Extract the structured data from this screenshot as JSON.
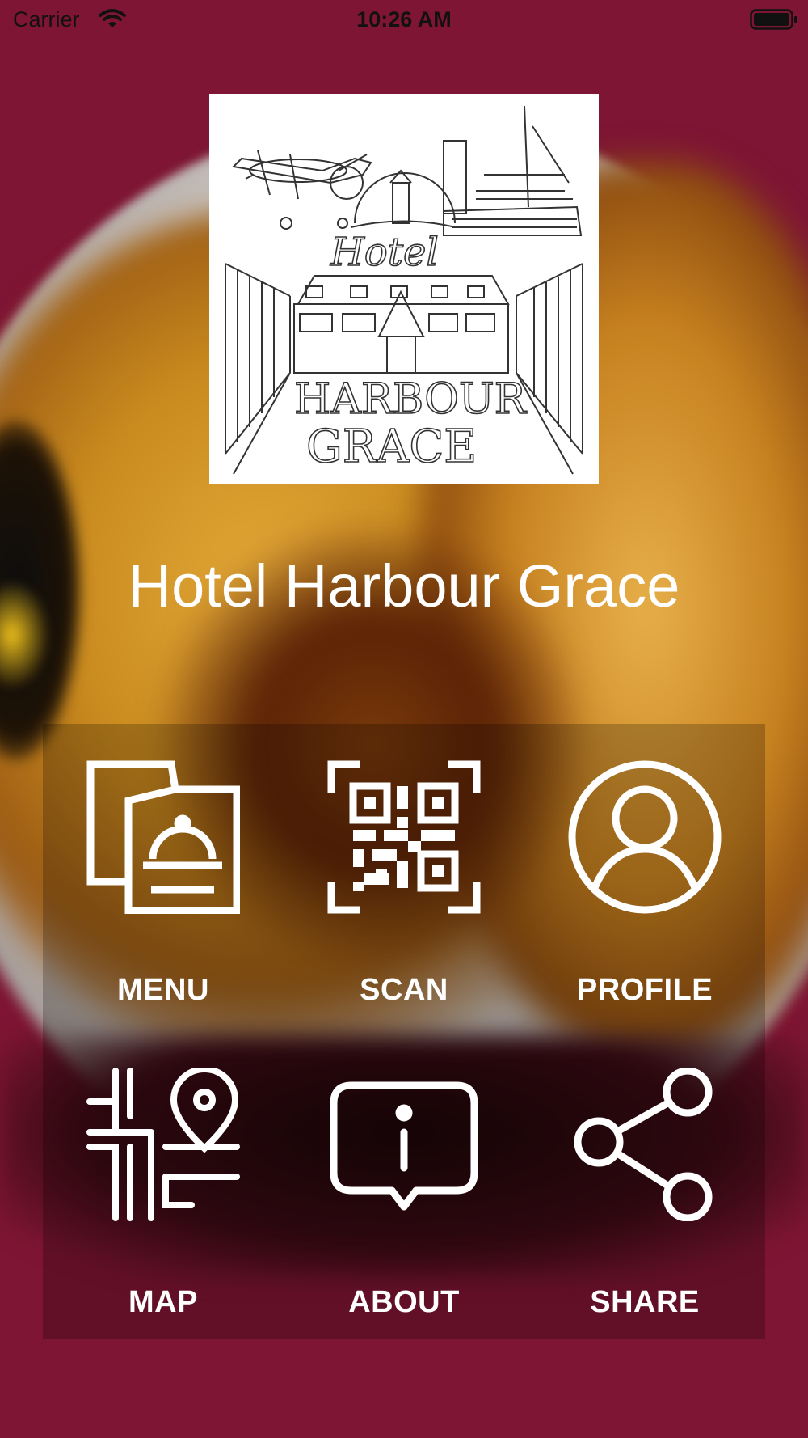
{
  "status_bar": {
    "carrier": "Carrier",
    "time": "10:26 AM"
  },
  "logo": {
    "icon": "hotel-harbour-grace-logo",
    "lines": [
      "Hotel",
      "HARBOUR",
      "GRACE"
    ]
  },
  "app_title": "Hotel Harbour Grace",
  "colors": {
    "background": "#7e1534",
    "text": "#ffffff"
  },
  "tiles": [
    {
      "label": "MENU",
      "icon": "menu-cloche-icon"
    },
    {
      "label": "SCAN",
      "icon": "qr-code-icon"
    },
    {
      "label": "PROFILE",
      "icon": "user-profile-icon"
    },
    {
      "label": "MAP",
      "icon": "map-pin-icon"
    },
    {
      "label": "ABOUT",
      "icon": "info-bubble-icon"
    },
    {
      "label": "SHARE",
      "icon": "share-icon"
    }
  ]
}
